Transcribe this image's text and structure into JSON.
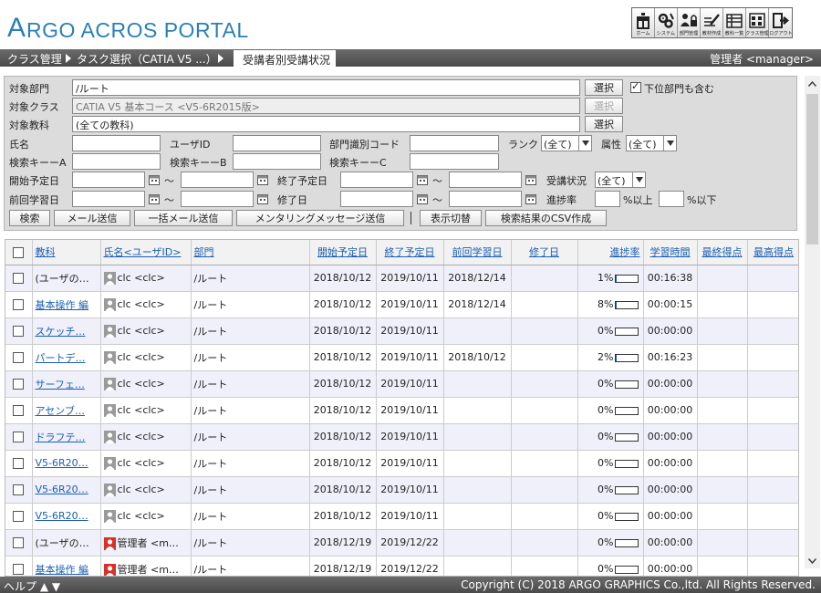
{
  "app": {
    "logo_a": "A",
    "logo_rest": "RGO ACROS PORTAL",
    "brand_color": "#2a7fb8"
  },
  "toolbar": [
    {
      "label": "ホーム",
      "icon": "home-icon"
    },
    {
      "label": "システム",
      "icon": "gears-icon"
    },
    {
      "label": "部門管理",
      "icon": "users-lock-icon"
    },
    {
      "label": "教材作成",
      "icon": "pen-edit-icon"
    },
    {
      "label": "教科一覧",
      "icon": "list-icon"
    },
    {
      "label": "クラス管理",
      "icon": "class-manage-icon"
    },
    {
      "label": "ログアウト",
      "icon": "logout-icon"
    }
  ],
  "breadcrumb": {
    "items": [
      "クラス管理",
      "タスク選択（CATIA V5 ...）"
    ],
    "active": "受講者別受講状況",
    "user": "管理者 <manager>"
  },
  "form": {
    "dept_label": "対象部門",
    "dept_value": "/ルート",
    "dept_select": "選択",
    "sub_dept_label": "下位部門も含む",
    "class_label": "対象クラス",
    "class_value": "CATIA V5 基本コース <V5-6R2015版>",
    "class_select": "選択",
    "subject_label": "対象教科",
    "subject_value": "(全ての教科)",
    "subject_select": "選択",
    "name_label": "氏名",
    "userid_label": "ユーザID",
    "deptcode_label": "部門識別コード",
    "rank_label": "ランク",
    "rank_value": "(全て)",
    "attr_label": "属性",
    "attr_value": "(全て)",
    "keya_label": "検索キーーA",
    "keyb_label": "検索キーーB",
    "keyc_label": "検索キーーC",
    "start_label": "開始予定日",
    "end_label": "終了予定日",
    "status_label": "受講状況",
    "status_value": "(全て)",
    "last_label": "前回学習日",
    "done_label": "修了日",
    "progress_label": "進捗率",
    "tilde": "～",
    "pct_above": "%以上",
    "pct_below": "%以下"
  },
  "buttons": {
    "search": "検索",
    "mail": "メール送信",
    "bulk_mail": "一括メール送信",
    "mentoring": "メンタリングメッセージ送信",
    "toggle": "表示切替",
    "csv": "検索結果のCSV作成"
  },
  "table": {
    "headers": [
      "教科",
      "氏名<ユーザID>",
      "部門",
      "開始予定日",
      "終了予定日",
      "前回学習日",
      "修了日",
      "進捗率",
      "学習時間",
      "最終得点",
      "最高得点"
    ],
    "rows": [
      {
        "subject": "(ユーザの…",
        "link": false,
        "user": "clc <clc>",
        "admin": false,
        "dept": "/ルート",
        "start": "2018/10/12",
        "end": "2019/10/11",
        "last": "2018/12/14",
        "done": "",
        "progress": "1%",
        "progress_value": 1,
        "time": "00:16:38",
        "last_score": "",
        "best_score": ""
      },
      {
        "subject": "基本操作 編",
        "link": true,
        "user": "clc <clc>",
        "admin": false,
        "dept": "/ルート",
        "start": "2018/10/12",
        "end": "2019/10/11",
        "last": "2018/12/14",
        "done": "",
        "progress": "8%",
        "progress_value": 8,
        "time": "00:00:15",
        "last_score": "",
        "best_score": ""
      },
      {
        "subject": "スケッチ…",
        "link": true,
        "user": "clc <clc>",
        "admin": false,
        "dept": "/ルート",
        "start": "2018/10/12",
        "end": "2019/10/11",
        "last": "",
        "done": "",
        "progress": "0%",
        "progress_value": 0,
        "time": "00:00:00",
        "last_score": "",
        "best_score": ""
      },
      {
        "subject": "パートデ…",
        "link": true,
        "user": "clc <clc>",
        "admin": false,
        "dept": "/ルート",
        "start": "2018/10/12",
        "end": "2019/10/11",
        "last": "2018/10/12",
        "done": "",
        "progress": "2%",
        "progress_value": 2,
        "time": "00:16:23",
        "last_score": "",
        "best_score": ""
      },
      {
        "subject": "サーフェ…",
        "link": true,
        "user": "clc <clc>",
        "admin": false,
        "dept": "/ルート",
        "start": "2018/10/12",
        "end": "2019/10/11",
        "last": "",
        "done": "",
        "progress": "0%",
        "progress_value": 0,
        "time": "00:00:00",
        "last_score": "",
        "best_score": ""
      },
      {
        "subject": "アセンブ…",
        "link": true,
        "user": "clc <clc>",
        "admin": false,
        "dept": "/ルート",
        "start": "2018/10/12",
        "end": "2019/10/11",
        "last": "",
        "done": "",
        "progress": "0%",
        "progress_value": 0,
        "time": "00:00:00",
        "last_score": "",
        "best_score": ""
      },
      {
        "subject": "ドラフテ…",
        "link": true,
        "user": "clc <clc>",
        "admin": false,
        "dept": "/ルート",
        "start": "2018/10/12",
        "end": "2019/10/11",
        "last": "",
        "done": "",
        "progress": "0%",
        "progress_value": 0,
        "time": "00:00:00",
        "last_score": "",
        "best_score": ""
      },
      {
        "subject": "V5-6R20…",
        "link": true,
        "user": "clc <clc>",
        "admin": false,
        "dept": "/ルート",
        "start": "2018/10/12",
        "end": "2019/10/11",
        "last": "",
        "done": "",
        "progress": "0%",
        "progress_value": 0,
        "time": "00:00:00",
        "last_score": "",
        "best_score": ""
      },
      {
        "subject": "V5-6R20…",
        "link": true,
        "user": "clc <clc>",
        "admin": false,
        "dept": "/ルート",
        "start": "2018/10/12",
        "end": "2019/10/11",
        "last": "",
        "done": "",
        "progress": "0%",
        "progress_value": 0,
        "time": "00:00:00",
        "last_score": "",
        "best_score": ""
      },
      {
        "subject": "V5-6R20…",
        "link": true,
        "user": "clc <clc>",
        "admin": false,
        "dept": "/ルート",
        "start": "2018/10/12",
        "end": "2019/10/11",
        "last": "",
        "done": "",
        "progress": "0%",
        "progress_value": 0,
        "time": "00:00:00",
        "last_score": "",
        "best_score": ""
      },
      {
        "subject": "(ユーザの…",
        "link": false,
        "user": "管理者 <m…",
        "admin": true,
        "dept": "/ルート",
        "start": "2018/12/19",
        "end": "2019/12/22",
        "last": "",
        "done": "",
        "progress": "0%",
        "progress_value": 0,
        "time": "00:00:00",
        "last_score": "",
        "best_score": ""
      },
      {
        "subject": "基本操作 編",
        "link": true,
        "user": "管理者 <m…",
        "admin": true,
        "dept": "/ルート",
        "start": "2018/12/19",
        "end": "2019/12/22",
        "last": "",
        "done": "",
        "progress": "0%",
        "progress_value": 0,
        "time": "00:00:00",
        "last_score": "",
        "best_score": ""
      }
    ]
  },
  "footer": {
    "help": "ヘルプ ▲ ▼",
    "copyright": "Copyright (C) 2018 ARGO GRAPHICS Co.,ltd. All Rights Reserved."
  }
}
